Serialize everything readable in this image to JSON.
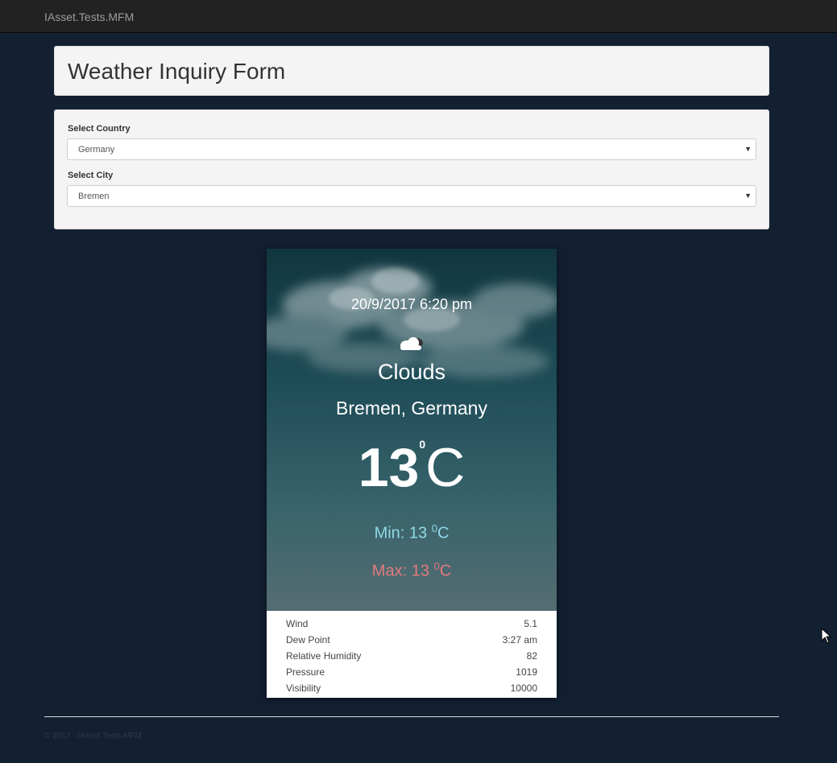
{
  "navbar": {
    "brand": "IAsset.Tests.MFM"
  },
  "header": {
    "title": "Weather Inquiry Form"
  },
  "form": {
    "country_label": "Select Country",
    "country_value": "Germany",
    "city_label": "Select City",
    "city_value": "Bremen"
  },
  "weather": {
    "datetime": "20/9/2017 6:20 pm",
    "icon": "cloud-icon",
    "condition": "Clouds",
    "location": "Bremen, Germany",
    "temperature": "13",
    "temp_degree": "0",
    "temp_unit": "C",
    "min_label": "Min: 13 ",
    "min_degree": "0",
    "min_unit": "C",
    "max_label": "Max: 13 ",
    "max_degree": "0",
    "max_unit": "C",
    "details": [
      {
        "label": "Wind",
        "value": "5.1"
      },
      {
        "label": "Dew Point",
        "value": "3:27 am"
      },
      {
        "label": "Relative Humidity",
        "value": "82"
      },
      {
        "label": "Pressure",
        "value": "1019"
      },
      {
        "label": "Visibility",
        "value": "10000"
      }
    ]
  },
  "footer": {
    "text": "© 2017 - IAsset.Tests.MFM"
  },
  "colors": {
    "page_background": "#122032",
    "navbar": "#222222",
    "min_temp": "#8fd8e6",
    "max_temp": "#e27a7f"
  }
}
